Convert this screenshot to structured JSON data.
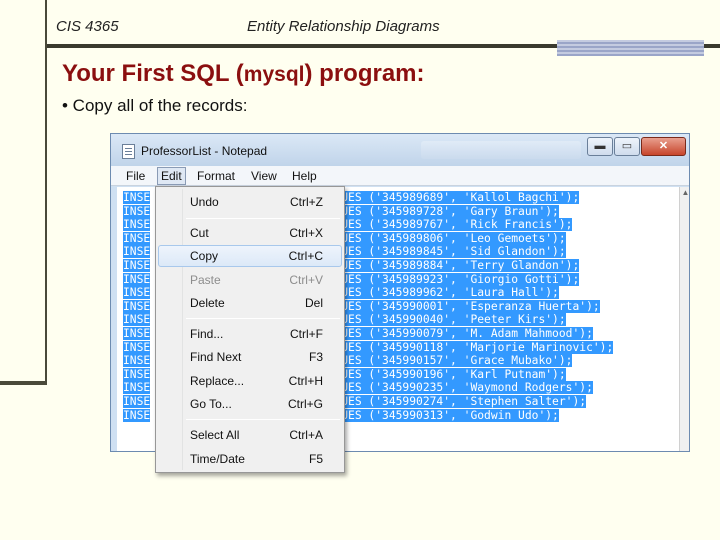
{
  "header": {
    "course": "CIS 4365",
    "topic": "Entity Relationship Diagrams"
  },
  "slide": {
    "title_pre": "Your First SQL (",
    "title_code": "mysql",
    "title_post": ") program:",
    "bullet": "• Copy all of the records:"
  },
  "window": {
    "title": "ProfessorList - Notepad",
    "min_glyph": "▬",
    "max_glyph": "▭",
    "close_glyph": "✕"
  },
  "menubar": {
    "file": "File",
    "edit": "Edit",
    "format": "Format",
    "view": "View",
    "help": "Help"
  },
  "editmenu": {
    "undo": "Undo",
    "undo_sc": "Ctrl+Z",
    "cut": "Cut",
    "cut_sc": "Ctrl+X",
    "copy": "Copy",
    "copy_sc": "Ctrl+C",
    "paste": "Paste",
    "paste_sc": "Ctrl+V",
    "delete": "Delete",
    "delete_sc": "Del",
    "find": "Find...",
    "find_sc": "Ctrl+F",
    "findnext": "Find Next",
    "findnext_sc": "F3",
    "replace": "Replace...",
    "replace_sc": "Ctrl+H",
    "goto": "Go To...",
    "goto_sc": "Ctrl+G",
    "selectall": "Select All",
    "selectall_sc": "Ctrl+A",
    "timedate": "Time/Date",
    "timedate_sc": "F5"
  },
  "records": [
    {
      "prefix": "INSE",
      "suffix": "UES ('345989689', 'Kallol Bagchi');"
    },
    {
      "prefix": "INSE",
      "suffix": "UES ('345989728', 'Gary Braun');"
    },
    {
      "prefix": "INSE",
      "suffix": "UES ('345989767', 'Rick Francis');"
    },
    {
      "prefix": "INSE",
      "suffix": "UES ('345989806', 'Leo Gemoets');"
    },
    {
      "prefix": "INSE",
      "suffix": "UES ('345989845', 'Sid Glandon');"
    },
    {
      "prefix": "INSE",
      "suffix": "UES ('345989884', 'Terry Glandon');"
    },
    {
      "prefix": "INSE",
      "suffix": "UES ('345989923', 'Giorgio Gotti');"
    },
    {
      "prefix": "INSE",
      "suffix": "UES ('345989962', 'Laura Hall');"
    },
    {
      "prefix": "INSE",
      "suffix": "UES ('345990001', 'Esperanza Huerta');"
    },
    {
      "prefix": "INSE",
      "suffix": "UES ('345990040', 'Peeter Kirs');"
    },
    {
      "prefix": "INSE",
      "suffix": "UES ('345990079', 'M. Adam Mahmood');"
    },
    {
      "prefix": "INSE",
      "suffix": "UES ('345990118', 'Marjorie Marinovic');"
    },
    {
      "prefix": "INSE",
      "suffix": "UES ('345990157', 'Grace Mubako');"
    },
    {
      "prefix": "INSE",
      "suffix": "UES ('345990196', 'Karl Putnam');"
    },
    {
      "prefix": "INSE",
      "suffix": "UES ('345990235', 'Waymond Rodgers');"
    },
    {
      "prefix": "INSE",
      "suffix": "UES ('345990274', 'Stephen Salter');"
    },
    {
      "prefix": "INSE",
      "suffix": "UES ('345990313', 'Godwin Udo');"
    }
  ],
  "colors": {
    "title": "#8b0f0f",
    "selection": "#3399ff",
    "rule": "#3a3a2e"
  }
}
